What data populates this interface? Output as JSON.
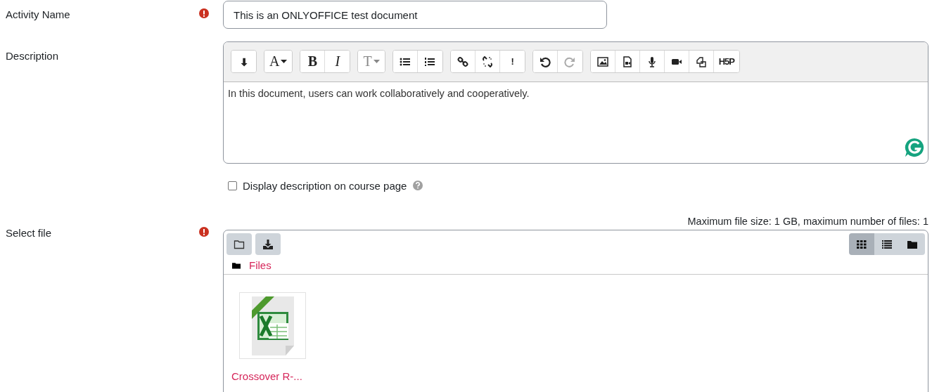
{
  "activity_name": {
    "label": "Activity Name",
    "required": true,
    "value": "This is an ONLYOFFICE test document"
  },
  "description": {
    "label": "Description",
    "toolbar": [
      [
        {
          "disabled": false
        }
      ],
      [
        {
          "label": "A",
          "disabled": false
        }
      ],
      [
        {
          "label": "B",
          "disabled": false
        },
        {
          "label": "I",
          "disabled": false
        }
      ],
      [
        {
          "label": "T",
          "disabled": false
        }
      ],
      [
        {
          "disabled": false
        },
        {
          "disabled": false
        }
      ],
      [
        {
          "disabled": false
        },
        {
          "disabled": false
        },
        {
          "label": "!",
          "disabled": false
        }
      ],
      [
        {
          "disabled": false
        },
        {
          "disabled": true
        }
      ],
      [
        {
          "disabled": false
        },
        {
          "disabled": false
        },
        {
          "disabled": false
        },
        {
          "disabled": false
        },
        {
          "disabled": false
        },
        {
          "label": "H5P",
          "disabled": false
        }
      ]
    ],
    "text": "In this document, users can work collaboratively and cooperatively."
  },
  "display_description": {
    "label": "Display description on course page",
    "checked": false
  },
  "select_file": {
    "label": "Select file",
    "required": true,
    "limits": "Maximum file size: 1 GB, maximum number of files: 1",
    "views": [
      {
        "selected": true
      },
      {
        "selected": false
      },
      {
        "selected": false
      }
    ],
    "path": "Files",
    "files": [
      {
        "name": "Crossover R-..."
      }
    ]
  }
}
